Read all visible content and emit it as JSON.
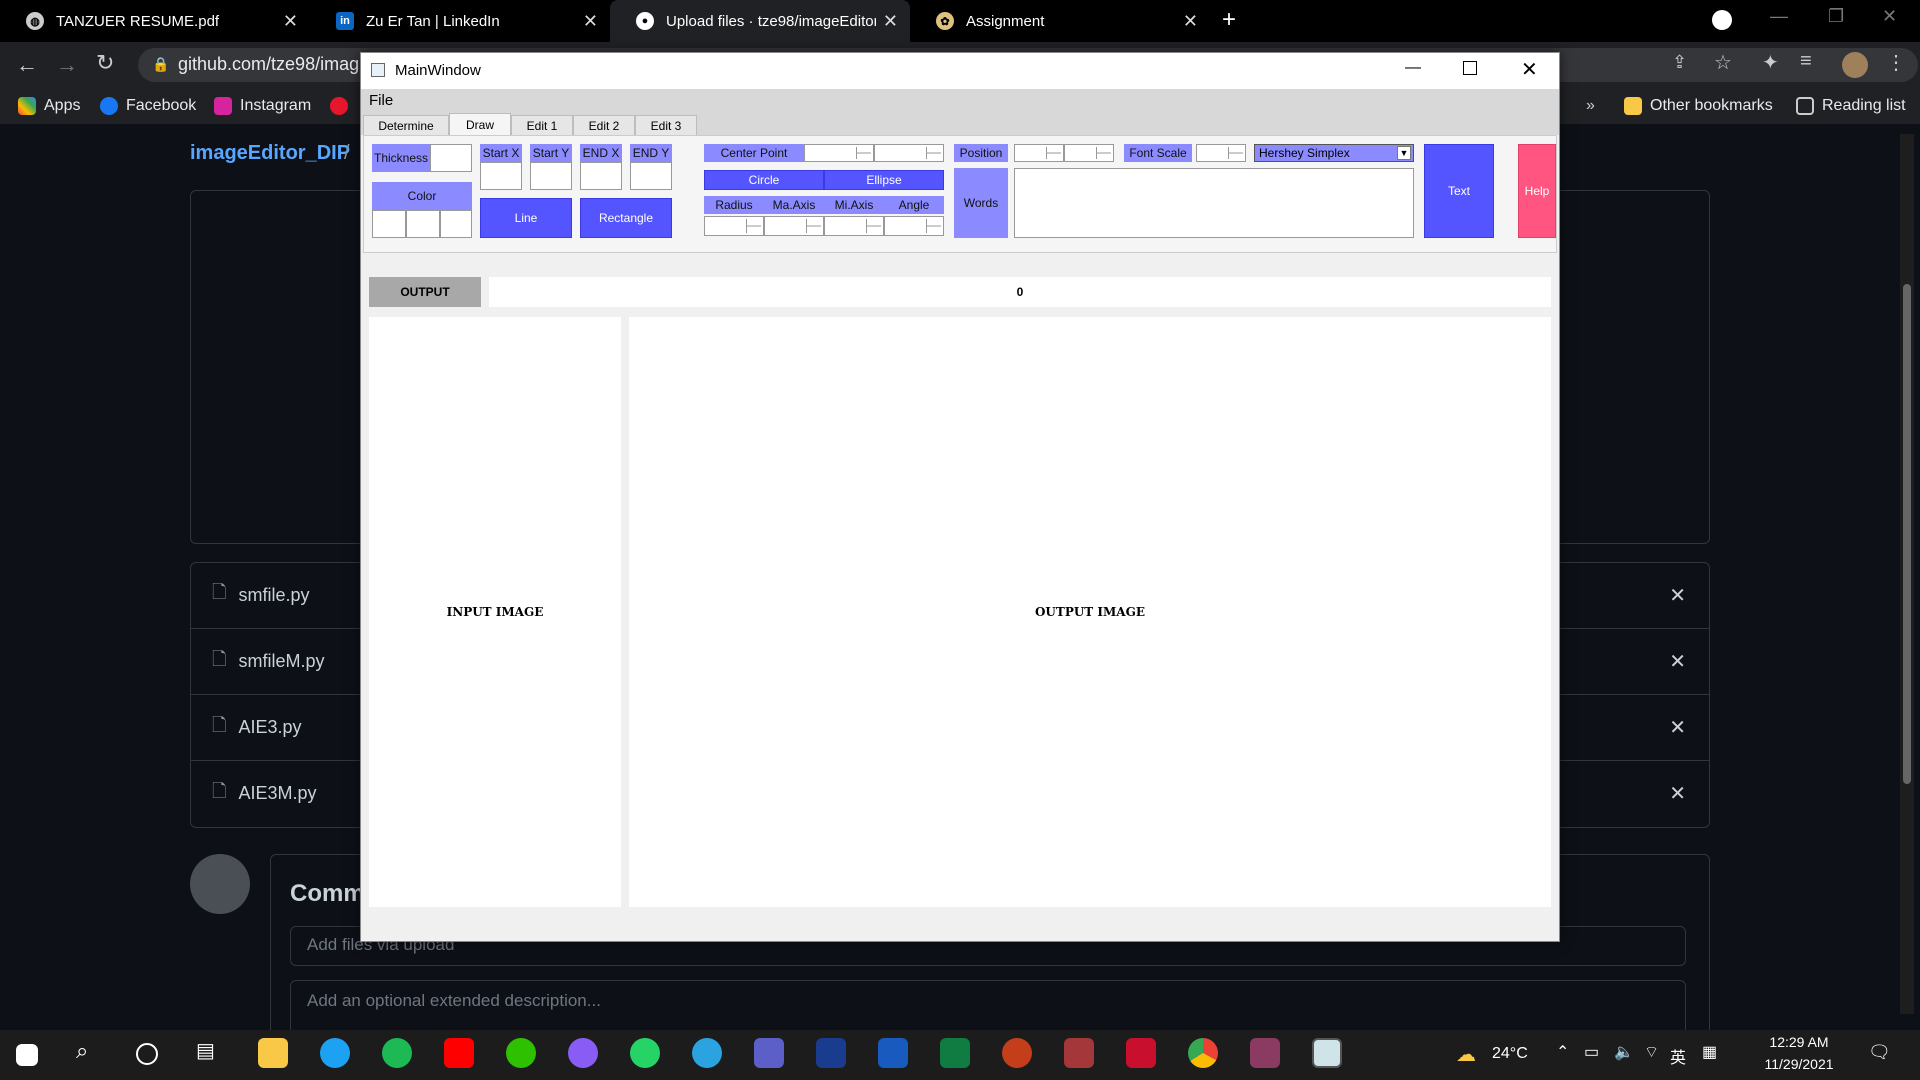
{
  "browser": {
    "tabs": [
      {
        "title": "TANZUER RESUME.pdf",
        "icon": "globe-icon"
      },
      {
        "title": "Zu Er Tan | LinkedIn",
        "icon": "linkedin-icon"
      },
      {
        "title": "Upload files · tze98/imageEditor_",
        "icon": "github-icon"
      },
      {
        "title": "Assignment",
        "icon": "assignment-icon"
      }
    ],
    "url": "github.com/tze98/imag",
    "bookmarks": [
      "Apps",
      "Facebook",
      "Instagram"
    ],
    "bookmarks_right": [
      "Other bookmarks",
      "Reading list"
    ],
    "overflow": "»"
  },
  "github": {
    "repo_link": "imageEditor_DIP",
    "sep": "/",
    "files": [
      "smfile.py",
      "smfileM.py",
      "AIE3.py",
      "AIE3M.py"
    ],
    "comment_heading": "Comm",
    "commit_placeholder": "Add files via upload",
    "desc_placeholder": "Add an optional extended description..."
  },
  "app": {
    "title": "MainWindow",
    "menu": [
      "File"
    ],
    "tabs": [
      "Determine",
      "Draw",
      "Edit 1",
      "Edit 2",
      "Edit 3"
    ],
    "selected_tab": "Draw",
    "labels": {
      "thickness": "Thickness",
      "color": "Color",
      "start_x": "Start X",
      "start_y": "Start Y",
      "end_x": "END X",
      "end_y": "END Y",
      "center_point": "Center Point",
      "radius": "Radius",
      "ma_axis": "Ma.Axis",
      "mi_axis": "Mi.Axis",
      "angle": "Angle",
      "position": "Position",
      "font_scale": "Font Scale",
      "words": "Words"
    },
    "buttons": {
      "line": "Line",
      "rectangle": "Rectangle",
      "circle": "Circle",
      "ellipse": "Ellipse",
      "text": "Text",
      "help": "Help"
    },
    "font_select": "Hershey Simplex",
    "output_label": "OUTPUT",
    "output_value": "0",
    "input_image": "INPUT IMAGE",
    "output_image": "OUTPUT IMAGE"
  },
  "taskbar": {
    "weather": "24°C",
    "time": "12:29 AM",
    "date": "11/29/2021",
    "ime": "英"
  },
  "colors": {
    "accent_blue": "#5555ff",
    "light_blue": "#8b8bff",
    "help_pink": "#ff5580",
    "link": "#58a6ff"
  }
}
